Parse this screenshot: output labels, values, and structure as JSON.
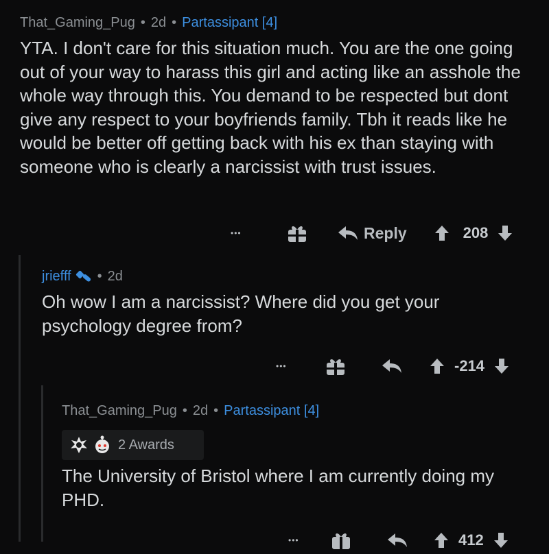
{
  "comments": [
    {
      "user": "That_Gaming_Pug",
      "age": "2d",
      "flair": "Partassipant [4]",
      "text": "YTA. I don't care for this situation much. You are the one going out of your way to harass this girl and acting like an asshole the whole way through this. You demand to be respected but dont give any respect to your boyfriends family. Tbh it reads like he would be better off getting back with his ex than staying with someone who is clearly a narcissist with trust issues.",
      "more": "•••",
      "reply_label": "Reply",
      "score": "208"
    },
    {
      "user": "jriefff",
      "age": "2d",
      "text": "Oh wow I am a narcissist? Where did you get your psychology degree from?",
      "more": "•••",
      "score": "-214"
    },
    {
      "user": "That_Gaming_Pug",
      "age": "2d",
      "flair": "Partassipant [4]",
      "awards": "2 Awards",
      "text": "The University of Bristol where I am currently doing my PHD.",
      "more": "•••",
      "score": "412"
    }
  ],
  "colors": {
    "background": "#0b0b0c",
    "flair": "#3d8fe0",
    "meta": "#8b8f93",
    "text": "#d7dadc"
  },
  "icons": [
    "gift-icon",
    "reply-icon",
    "upvote-icon",
    "downvote-icon",
    "mod-badge-icon",
    "award-icon"
  ]
}
